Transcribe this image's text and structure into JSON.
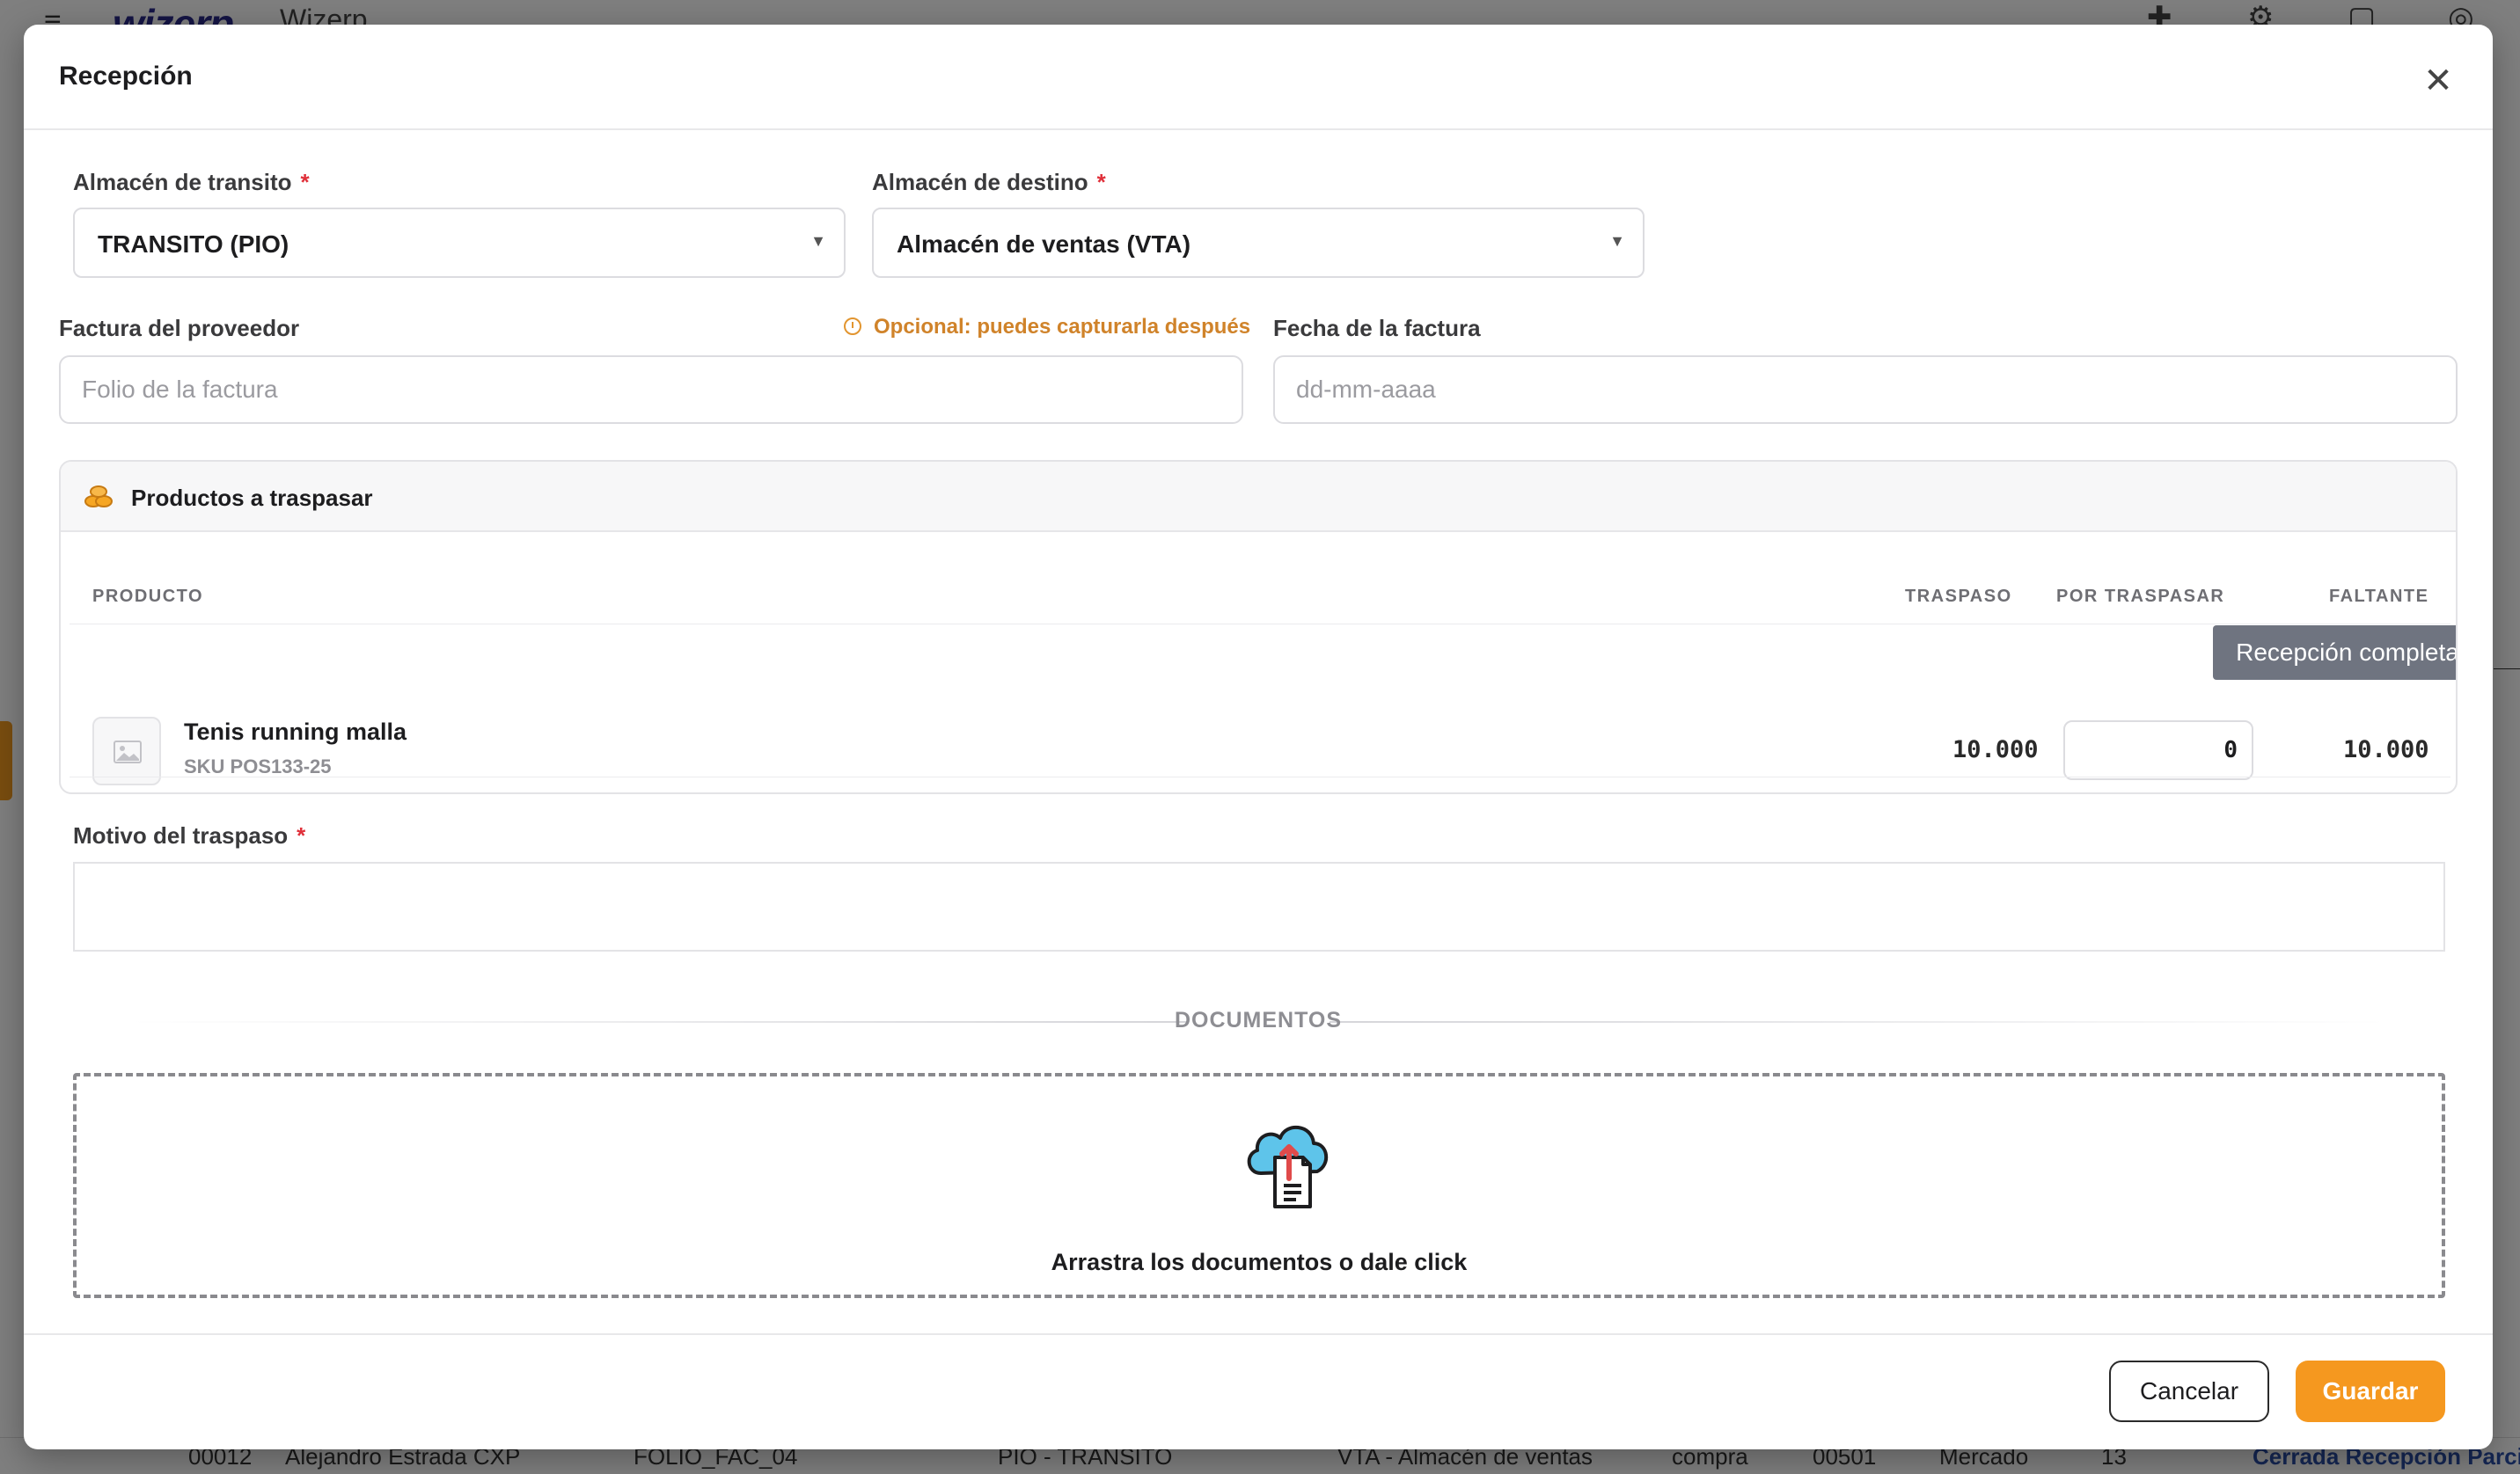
{
  "background": {
    "brand_logo": "wizerp",
    "app_name": "Wizerp",
    "row": [
      "00012",
      "Alejandro Estrada CXP",
      "FOLIO_FAC_04",
      "PIO - TRANSITO",
      "VTA - Almacén de ventas",
      "compra",
      "00501",
      "Mercado",
      "13",
      "Cerrada Recepción Parcial"
    ],
    "icons": [
      "menu-icon",
      "plus-icon",
      "gear-icon",
      "calendar-icon",
      "support-icon"
    ]
  },
  "modal": {
    "title": "Recepción",
    "close_icon": "close-icon"
  },
  "form": {
    "transit": {
      "label": "Almacén de transito",
      "required": "*",
      "value": "TRANSITO (PIO)"
    },
    "destination": {
      "label": "Almacén de destino",
      "required": "*",
      "value": "Almacén de ventas (VTA)"
    },
    "invoice": {
      "label": "Factura del proveedor",
      "placeholder": "Folio de la factura",
      "value": ""
    },
    "optional_note": "Opcional: puedes capturarla después",
    "date": {
      "label": "Fecha de la factura",
      "placeholder": "dd-mm-aaaa",
      "value": ""
    }
  },
  "products": {
    "title": "Productos a traspasar",
    "icon": "coins-icon",
    "columns": [
      "PRODUCTO",
      "TRASPASO",
      "POR TRASPASAR",
      "FALTANTE"
    ],
    "tooltip": "Recepción completa",
    "rows": [
      {
        "name": "Tenis running malla",
        "sku": "SKU POS133-25",
        "traspaso": "10.000",
        "por_traspasar": "0",
        "faltante": "10.000",
        "image_icon": "image-placeholder-icon"
      }
    ]
  },
  "reason": {
    "label": "Motivo del traspaso",
    "required": "*",
    "value": ""
  },
  "documents": {
    "heading": "DOCUMENTOS",
    "dropzone_text": "Arrastra los documentos o dale click",
    "icon": "cloud-upload-icon"
  },
  "footer": {
    "cancel_label": "Cancelar",
    "save_label": "Guardar"
  },
  "colors": {
    "accent": "#f5981f",
    "required": "#e0303a",
    "warning": "#d0832a",
    "tooltip_bg": "#6f7480"
  }
}
